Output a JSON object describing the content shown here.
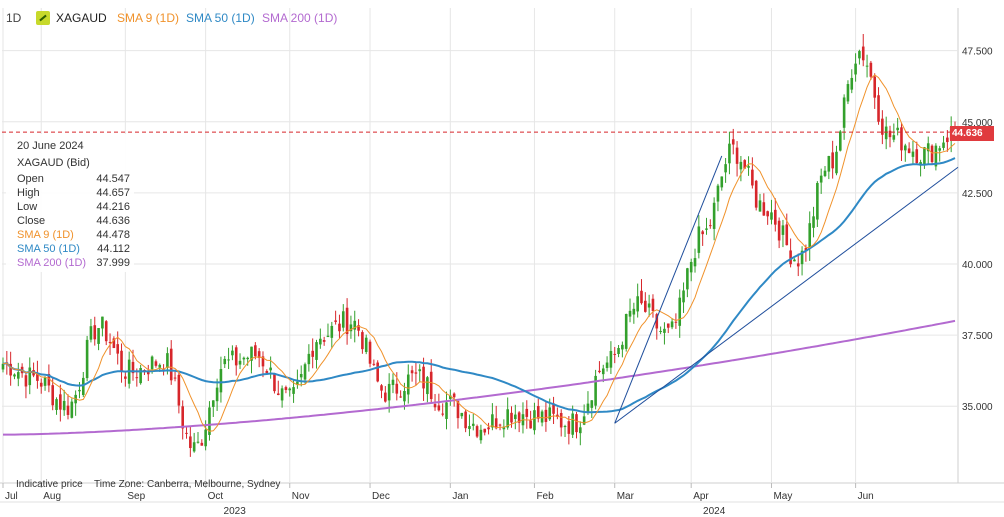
{
  "header": {
    "timeframe": "1D",
    "symbol": "XAGAUD",
    "legend": [
      {
        "label": "SMA 9 (1D)",
        "color": "#f0922b"
      },
      {
        "label": "SMA 50 (1D)",
        "color": "#2f89c5"
      },
      {
        "label": "SMA 200 (1D)",
        "color": "#b36ad0"
      }
    ]
  },
  "tooltip": {
    "date": "20 June 2024",
    "instrument": "XAGAUD (Bid)",
    "rows": [
      {
        "label": "Open",
        "value": "44.547"
      },
      {
        "label": "High",
        "value": "44.657"
      },
      {
        "label": "Low",
        "value": "44.216"
      },
      {
        "label": "Close",
        "value": "44.636"
      },
      {
        "label": "SMA 9 (1D)",
        "value": "44.478",
        "color": "#f0922b"
      },
      {
        "label": "SMA 50 (1D)",
        "value": "44.112",
        "color": "#2f89c5"
      },
      {
        "label": "SMA 200 (1D)",
        "value": "37.999",
        "color": "#b36ad0"
      }
    ]
  },
  "footer": {
    "indicative": "Indicative price",
    "timezone": "Time Zone: Canberra, Melbourne, Sydney"
  },
  "current_price_label": "44.636",
  "colors": {
    "up": "#33a02c",
    "down": "#d7262b",
    "grid": "#e6e6e6",
    "price_line": "#d7262b",
    "trendline": "#1f4e9c"
  },
  "chart_data": {
    "type": "candlestick",
    "title": "XAGAUD",
    "ylim": [
      32.3,
      49.0
    ],
    "y_ticks": [
      "35.000",
      "37.500",
      "40.000",
      "42.500",
      "45.000",
      "47.500"
    ],
    "y_tick_values": [
      35.0,
      37.5,
      40.0,
      42.5,
      45.0,
      47.5
    ],
    "x_months": [
      "Jul",
      "Aug",
      "Sep",
      "Oct",
      "Nov",
      "Dec",
      "Jan",
      "Feb",
      "Mar",
      "Apr",
      "May",
      "Jun"
    ],
    "x_years": [
      "2023",
      "2024"
    ],
    "last_close": 44.636,
    "key_closes": [
      {
        "date": "Jul",
        "close": 36.5
      },
      {
        "date": "Mid Jul",
        "close": 36.0
      },
      {
        "date": "Early Aug",
        "close": 35.0
      },
      {
        "date": "Late Aug",
        "close": 37.8
      },
      {
        "date": "Mid Sep",
        "close": 36.2
      },
      {
        "date": "Late Sep",
        "close": 36.6
      },
      {
        "date": "Early Oct",
        "close": 33.5
      },
      {
        "date": "Mid Oct",
        "close": 36.5
      },
      {
        "date": "Late Oct",
        "close": 36.8
      },
      {
        "date": "Mid Nov",
        "close": 35.2
      },
      {
        "date": "Late Nov",
        "close": 37.5
      },
      {
        "date": "Early Dec",
        "close": 38.0
      },
      {
        "date": "Mid Dec",
        "close": 35.5
      },
      {
        "date": "Late Dec",
        "close": 36.0
      },
      {
        "date": "Early Jan",
        "close": 35.1
      },
      {
        "date": "Late Jan",
        "close": 34.3
      },
      {
        "date": "Early Feb",
        "close": 34.8
      },
      {
        "date": "Mid Feb",
        "close": 34.6
      },
      {
        "date": "Late Feb",
        "close": 34.4
      },
      {
        "date": "Early Mar",
        "close": 36.5
      },
      {
        "date": "Mid Mar",
        "close": 38.5
      },
      {
        "date": "Late Mar",
        "close": 37.5
      },
      {
        "date": "Early Apr",
        "close": 41.0
      },
      {
        "date": "Mid Apr",
        "close": 44.0
      },
      {
        "date": "Late Apr",
        "close": 42.0
      },
      {
        "date": "Early May",
        "close": 40.2
      },
      {
        "date": "Mid May",
        "close": 43.5
      },
      {
        "date": "Late May",
        "close": 47.5
      },
      {
        "date": "Early Jun",
        "close": 44.5
      },
      {
        "date": "Mid Jun",
        "close": 43.9
      },
      {
        "date": "20 June 2024",
        "close": 44.636
      }
    ],
    "series": [
      {
        "name": "SMA 9 (1D)",
        "color": "#f0922b"
      },
      {
        "name": "SMA 50 (1D)",
        "color": "#2f89c5"
      },
      {
        "name": "SMA 200 (1D)",
        "color": "#b36ad0",
        "start": 34.0,
        "end": 37.999
      }
    ]
  }
}
